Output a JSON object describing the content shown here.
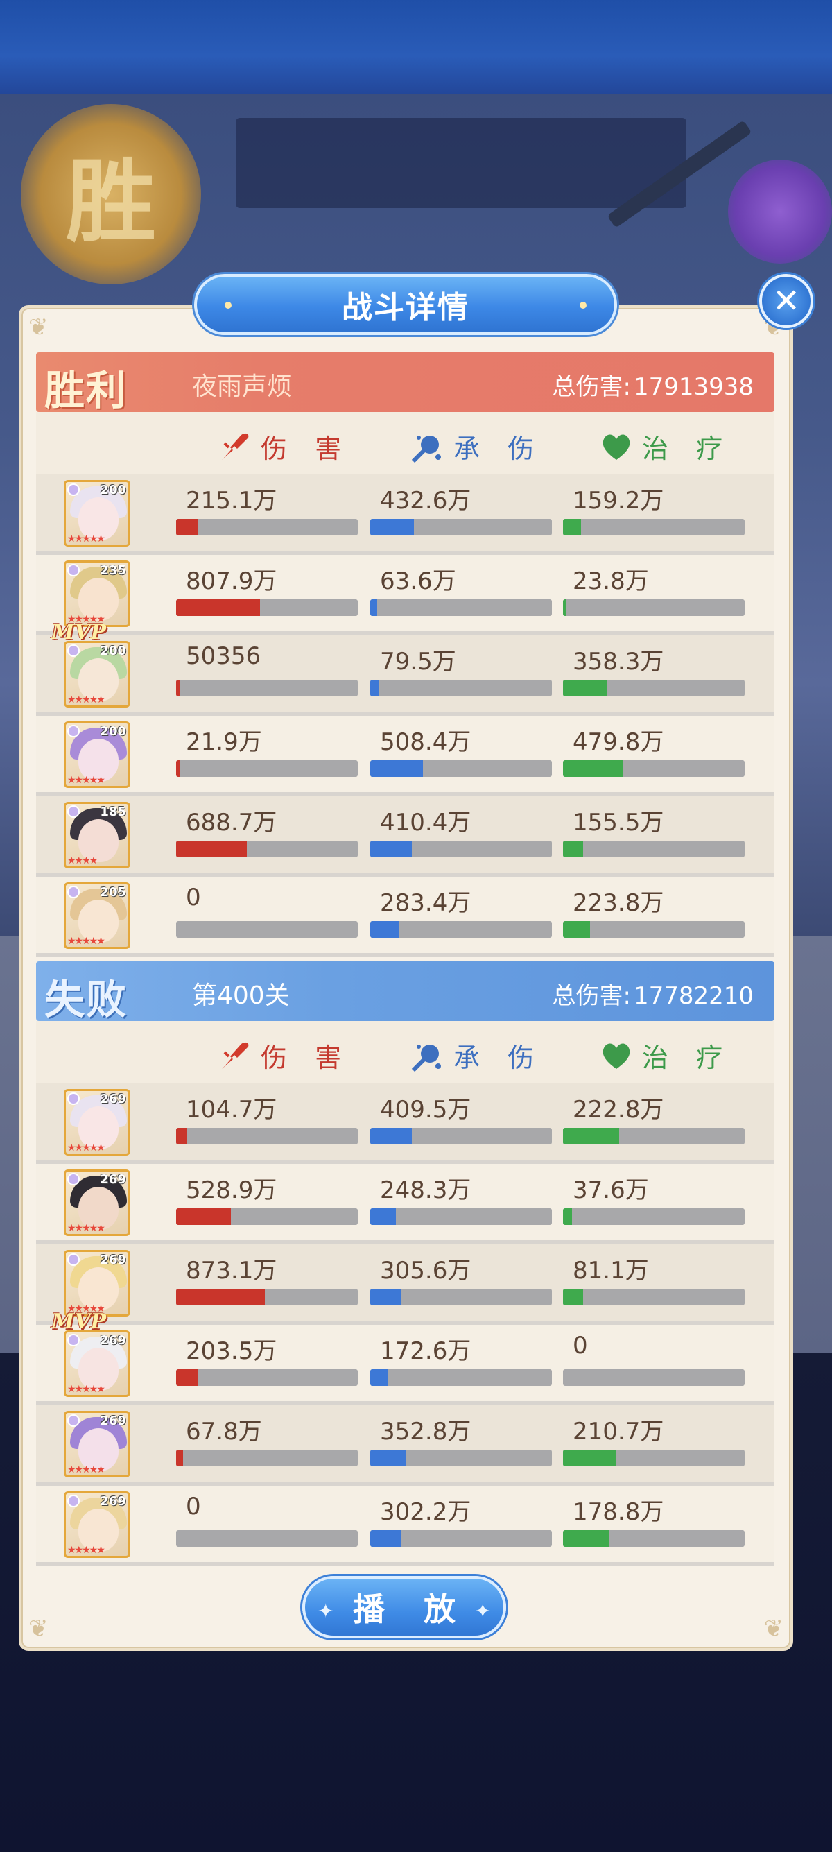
{
  "dialog": {
    "title": "战斗详情",
    "play_label": "播 放",
    "seal_char": "胜"
  },
  "columns": {
    "damage": "伤 害",
    "taken": "承 伤",
    "heal": "治 疗"
  },
  "colors": {
    "damage": "#c9352b",
    "taken": "#3d78d6",
    "heal": "#3faa4d",
    "win_header": "#e67d6a",
    "lose_header": "#6aa0e2"
  },
  "winner": {
    "result": "胜利",
    "name": "夜雨声烦",
    "total_label": "总伤害:",
    "total_value": "17913938",
    "members": [
      {
        "level": "200",
        "stars": "★★★★★",
        "mvp": false,
        "damage": "215.1万",
        "taken": "432.6万",
        "heal": "159.2万",
        "dmg_pct": 12,
        "taken_pct": 24,
        "heal_pct": 10,
        "hair": "#e9e3f0",
        "face": "#f9e6e6"
      },
      {
        "level": "235",
        "stars": "★★★★★",
        "mvp": true,
        "damage": "807.9万",
        "taken": "63.6万",
        "heal": "23.8万",
        "dmg_pct": 46,
        "taken_pct": 4,
        "heal_pct": 2,
        "hair": "#e0c98a",
        "face": "#f8e3cf"
      },
      {
        "level": "200",
        "stars": "★★★★★",
        "mvp": false,
        "damage": "50356",
        "taken": "79.5万",
        "heal": "358.3万",
        "dmg_pct": 1,
        "taken_pct": 5,
        "heal_pct": 24,
        "hair": "#b9d8a2",
        "face": "#f6e7d7"
      },
      {
        "level": "200",
        "stars": "★★★★★",
        "mvp": false,
        "damage": "21.9万",
        "taken": "508.4万",
        "heal": "479.8万",
        "dmg_pct": 1,
        "taken_pct": 29,
        "heal_pct": 33,
        "hair": "#a98bd8",
        "face": "#f5e1ea"
      },
      {
        "level": "185",
        "stars": "★★★★",
        "mvp": false,
        "damage": "688.7万",
        "taken": "410.4万",
        "heal": "155.5万",
        "dmg_pct": 39,
        "taken_pct": 23,
        "heal_pct": 11,
        "hair": "#3b3640",
        "face": "#f4ddd5"
      },
      {
        "level": "205",
        "stars": "★★★★★",
        "mvp": false,
        "damage": "0",
        "taken": "283.4万",
        "heal": "223.8万",
        "dmg_pct": 0,
        "taken_pct": 16,
        "heal_pct": 15,
        "hair": "#e4c696",
        "face": "#f8e6d3"
      }
    ]
  },
  "loser": {
    "result": "失败",
    "name": "第400关",
    "total_label": "总伤害:",
    "total_value": "17782210",
    "members": [
      {
        "level": "269",
        "stars": "★★★★★",
        "mvp": false,
        "damage": "104.7万",
        "taken": "409.5万",
        "heal": "222.8万",
        "dmg_pct": 6,
        "taken_pct": 23,
        "heal_pct": 31,
        "hair": "#e9e3f0",
        "face": "#f9e6e6"
      },
      {
        "level": "269",
        "stars": "★★★★★",
        "mvp": false,
        "damage": "528.9万",
        "taken": "248.3万",
        "heal": "37.6万",
        "dmg_pct": 30,
        "taken_pct": 14,
        "heal_pct": 5,
        "hair": "#2f2c33",
        "face": "#f1d9c9"
      },
      {
        "level": "269",
        "stars": "★★★★★",
        "mvp": true,
        "damage": "873.1万",
        "taken": "305.6万",
        "heal": "81.1万",
        "dmg_pct": 49,
        "taken_pct": 17,
        "heal_pct": 11,
        "hair": "#f0d891",
        "face": "#f9e6d2"
      },
      {
        "level": "269",
        "stars": "★★★★★",
        "mvp": false,
        "damage": "203.5万",
        "taken": "172.6万",
        "heal": "0",
        "dmg_pct": 12,
        "taken_pct": 10,
        "heal_pct": 0,
        "hair": "#eeeef2",
        "face": "#f7e4e2"
      },
      {
        "level": "269",
        "stars": "★★★★★",
        "mvp": false,
        "damage": "67.8万",
        "taken": "352.8万",
        "heal": "210.7万",
        "dmg_pct": 4,
        "taken_pct": 20,
        "heal_pct": 29,
        "hair": "#9f84d6",
        "face": "#f4e0ea"
      },
      {
        "level": "269",
        "stars": "★★★★★",
        "mvp": false,
        "damage": "0",
        "taken": "302.2万",
        "heal": "178.8万",
        "dmg_pct": 0,
        "taken_pct": 17,
        "heal_pct": 25,
        "hair": "#ecd59d",
        "face": "#f8e6d3"
      }
    ]
  }
}
